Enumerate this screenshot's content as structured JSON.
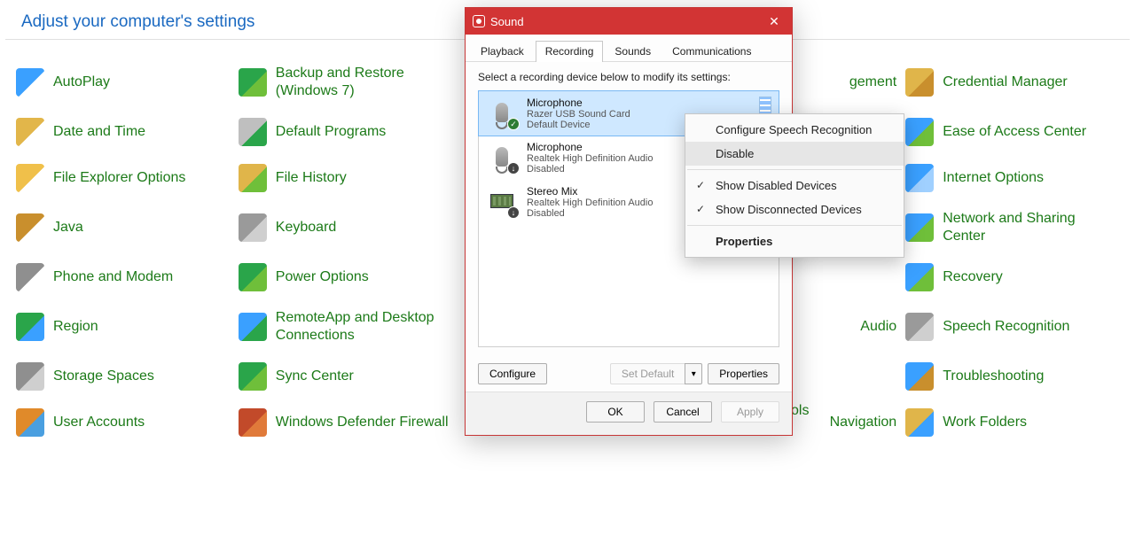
{
  "header": {
    "title": "Adjust your computer's settings"
  },
  "items": {
    "col1": [
      "AutoPlay",
      "Date and Time",
      "File Explorer Options",
      "Java",
      "Phone and Modem",
      "Region",
      "Storage Spaces",
      "User Accounts"
    ],
    "col2": [
      "Backup and Restore (Windows 7)",
      "Default Programs",
      "File History",
      "Keyboard",
      "Power Options",
      "RemoteApp and Desktop Connections",
      "Sync Center",
      "Windows Defender Firewall"
    ],
    "col3": [
      "",
      "",
      "",
      "",
      "",
      "",
      "",
      ""
    ],
    "col4_tails": [
      "gement",
      "",
      "",
      "",
      "",
      "Audio",
      "",
      "Navigation",
      "ols"
    ],
    "col5": [
      "Credential Manager",
      "Ease of Access Center",
      "Internet Options",
      "Network and Sharing Center",
      "Recovery",
      "Speech Recognition",
      "Troubleshooting",
      "Work Folders"
    ]
  },
  "dialog": {
    "title": "Sound",
    "tabs": [
      "Playback",
      "Recording",
      "Sounds",
      "Communications"
    ],
    "active_tab": 1,
    "hint": "Select a recording device below to modify its settings:",
    "devices": [
      {
        "name": "Microphone",
        "desc": "Razer USB Sound Card",
        "state": "Default Device",
        "selected": true,
        "badge": "ok",
        "level": true,
        "icon": "mic"
      },
      {
        "name": "Microphone",
        "desc": "Realtek High Definition Audio",
        "state": "Disabled",
        "selected": false,
        "badge": "down",
        "level": false,
        "icon": "mic"
      },
      {
        "name": "Stereo Mix",
        "desc": "Realtek High Definition Audio",
        "state": "Disabled",
        "selected": false,
        "badge": "down",
        "level": false,
        "icon": "chip"
      }
    ],
    "configure": "Configure",
    "set_default": "Set Default",
    "properties": "Properties",
    "ok": "OK",
    "cancel": "Cancel",
    "apply": "Apply"
  },
  "context_menu": {
    "items": [
      {
        "label": "Configure Speech Recognition",
        "type": "item"
      },
      {
        "label": "Disable",
        "type": "item",
        "highlight": true
      },
      {
        "type": "sep"
      },
      {
        "label": "Show Disabled Devices",
        "type": "check"
      },
      {
        "label": "Show Disconnected Devices",
        "type": "check"
      },
      {
        "type": "sep"
      },
      {
        "label": "Properties",
        "type": "item",
        "bold": true
      }
    ]
  },
  "icon_colors": {
    "col1": [
      "#3aa0ff,#fff",
      "#e2b64a,#fff",
      "#f0c04a,#fff",
      "#c98f2d,#fff",
      "#8f8f8f,#fff",
      "#2aa54a,#3aa0ff",
      "#8f8f8f,#cfcfcf",
      "#e08a2a,#4a9fe0"
    ],
    "col2": [
      "#2aa54a,#6fbf3a",
      "#bfbfbf,#2aa54a",
      "#e0b54a,#6fbf3a",
      "#9a9a9a,#cfcfcf",
      "#2aa54a,#6fbf3a",
      "#3aa0ff,#2aa54a",
      "#2aa54a,#6fbf3a",
      "#c24a2a,#e07a3a"
    ],
    "col5": [
      "#e0b54a,#c98f2d",
      "#3aa0ff,#6fbf3a",
      "#3aa0ff,#a0d0ff",
      "#3aa0ff,#6fbf3a",
      "#3aa0ff,#6fbf3a",
      "#9a9a9a,#cfcfcf",
      "#3aa0ff,#c98f2d",
      "#e0b54a,#3aa0ff"
    ]
  }
}
